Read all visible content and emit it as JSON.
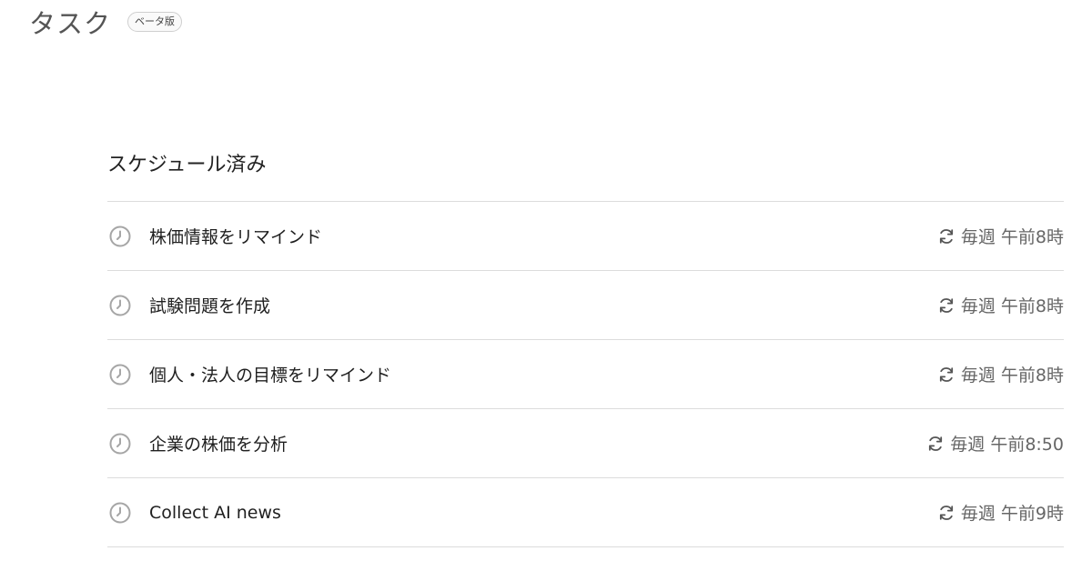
{
  "header": {
    "title": "タスク",
    "badge": "ベータ版"
  },
  "scheduled": {
    "title": "スケジュール済み",
    "tasks": [
      {
        "name": "株価情報をリマインド",
        "schedule": "毎週 午前8時"
      },
      {
        "name": "試験問題を作成",
        "schedule": "毎週 午前8時"
      },
      {
        "name": "個人・法人の目標をリマインド",
        "schedule": "毎週 午前8時"
      },
      {
        "name": "企業の株価を分析",
        "schedule": "毎週 午前8:50"
      },
      {
        "name": "Collect AI news",
        "schedule": "毎週 午前9時"
      }
    ]
  },
  "icons": {
    "task_status": "clock-icon",
    "recurrence": "repeat-icon"
  },
  "colors": {
    "icon_gray": "#a6a6a6",
    "divider": "#dcdcdc",
    "schedule_text": "#666666"
  }
}
